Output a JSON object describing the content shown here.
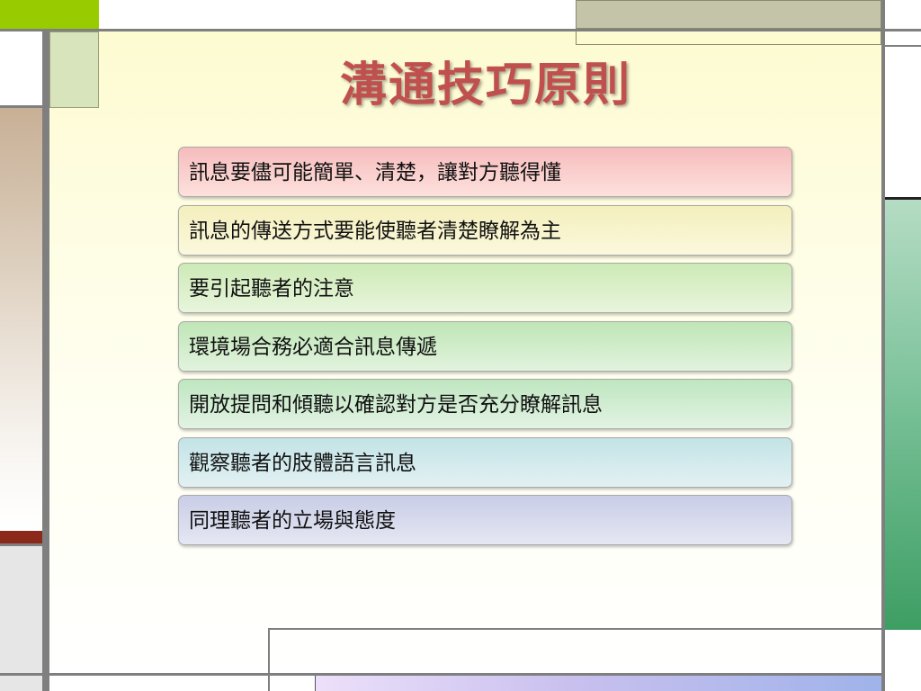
{
  "slide": {
    "title": "溝通技巧原則",
    "items": [
      {
        "label": "訊息要儘可能簡單、清楚，讓對方聽得懂",
        "colors": [
          "#f6bcbc",
          "#fde1dd"
        ]
      },
      {
        "label": "訊息的傳送方式要能使聽者清楚瞭解為主",
        "colors": [
          "#f4efbd",
          "#fbf8dc"
        ]
      },
      {
        "label": "要引起聽者的注意",
        "colors": [
          "#cdeab6",
          "#e8f5dc"
        ]
      },
      {
        "label": "環境場合務必適合訊息傳遞",
        "colors": [
          "#bfe6b6",
          "#e2f3de"
        ]
      },
      {
        "label": "開放提問和傾聽以確認對方是否充分瞭解訊息",
        "colors": [
          "#bfe6c0",
          "#e2f3e3"
        ]
      },
      {
        "label": "觀察聽者的肢體語言訊息",
        "colors": [
          "#c3e3e6",
          "#e2f1f3"
        ]
      },
      {
        "label": "同理聽者的立場與態度",
        "colors": [
          "#c9cde6",
          "#e5e7f3"
        ]
      }
    ]
  },
  "colors": {
    "title": "#c0504d",
    "frame": "#7f7f7f",
    "accent_green": "#99cc00",
    "right_column_green": "#3d9e63",
    "left_accent_red": "#8b2a1a"
  }
}
